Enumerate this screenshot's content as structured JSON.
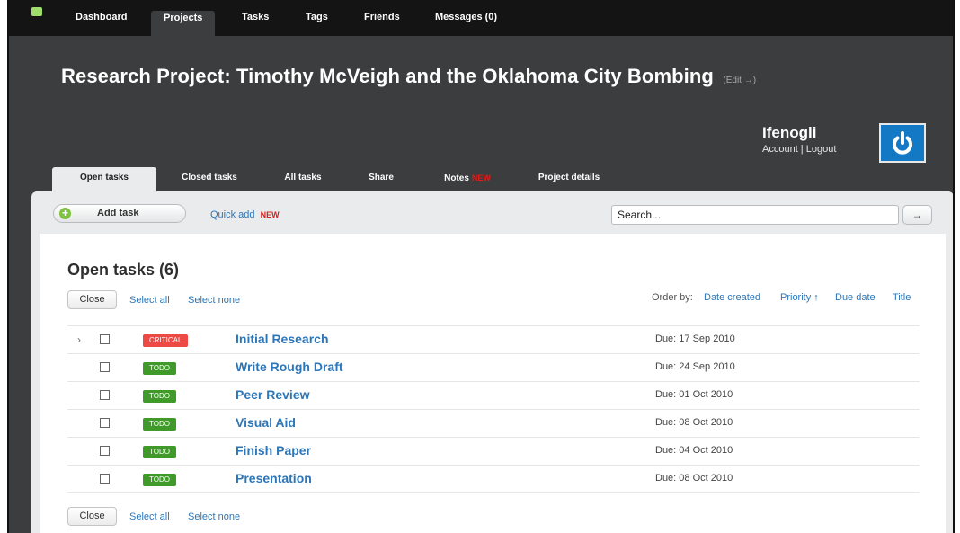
{
  "nav": {
    "items": [
      {
        "label": "Dashboard",
        "active": false
      },
      {
        "label": "Projects",
        "active": true
      },
      {
        "label": "Tasks",
        "active": false
      },
      {
        "label": "Tags",
        "active": false
      },
      {
        "label": "Friends",
        "active": false
      },
      {
        "label": "Messages (0)",
        "active": false
      }
    ]
  },
  "header": {
    "title": "Research Project: Timothy McVeigh and the Oklahoma City Bombing",
    "edit_label": "(Edit →)"
  },
  "user": {
    "name": "Ifenogli",
    "account_label": "Account",
    "separator": " | ",
    "logout_label": "Logout",
    "avatar_icon": "power-icon"
  },
  "tabs": [
    {
      "label": "Open tasks",
      "active": true,
      "badge": ""
    },
    {
      "label": "Closed tasks",
      "active": false,
      "badge": ""
    },
    {
      "label": "All tasks",
      "active": false,
      "badge": ""
    },
    {
      "label": "Share",
      "active": false,
      "badge": ""
    },
    {
      "label": "Notes",
      "active": false,
      "badge": "NEW"
    },
    {
      "label": "Project details",
      "active": false,
      "badge": ""
    }
  ],
  "toolbar": {
    "add_task_label": "Add task",
    "quick_add_label": "Quick add",
    "quick_add_badge": "NEW",
    "search_placeholder": "Search...",
    "search_go_label": "→"
  },
  "list": {
    "heading": "Open tasks (6)",
    "close_label": "Close",
    "select_all_label": "Select all",
    "select_none_label": "Select none",
    "order_by_label": "Order by:",
    "order_options": [
      "Date created",
      "Priority ↑",
      "Due date",
      "Title"
    ],
    "tasks": [
      {
        "status": "CRITICAL",
        "title": "Initial Research",
        "due": "Due: 17 Sep 2010",
        "expandable": true
      },
      {
        "status": "TODO",
        "title": "Write Rough Draft",
        "due": "Due: 24 Sep 2010",
        "expandable": false
      },
      {
        "status": "TODO",
        "title": "Peer Review",
        "due": "Due: 01 Oct 2010",
        "expandable": false
      },
      {
        "status": "TODO",
        "title": "Visual Aid",
        "due": "Due: 08 Oct 2010",
        "expandable": false
      },
      {
        "status": "TODO",
        "title": "Finish Paper",
        "due": "Due: 04 Oct 2010",
        "expandable": false
      },
      {
        "status": "TODO",
        "title": "Presentation",
        "due": "Due: 08 Oct 2010",
        "expandable": false
      }
    ]
  },
  "colors": {
    "nav_bg": "#141414",
    "header_bg": "#3c3d3e",
    "link": "#2c76b8",
    "critical": "#ec4a43",
    "todo": "#3f9a2a",
    "new_badge": "#d8201c",
    "avatar_bg": "#1479c4"
  }
}
